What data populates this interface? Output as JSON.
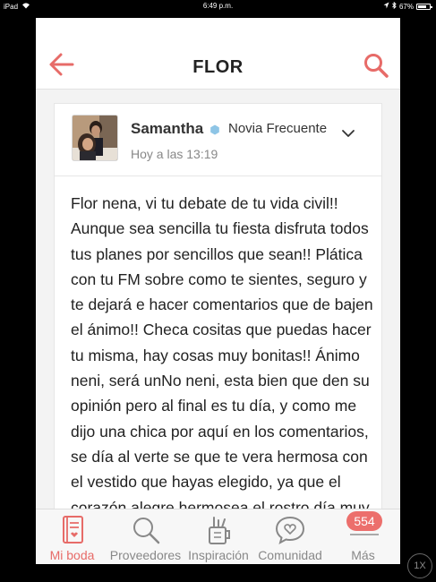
{
  "status_bar": {
    "device": "iPad",
    "time": "6:49 p.m.",
    "battery": "67%"
  },
  "header": {
    "title": "FLOR"
  },
  "post": {
    "author": "Samantha",
    "badge": "Novia Frecuente",
    "timestamp": "Hoy a las 13:19",
    "body": "Flor nena, vi tu debate de tu vida civil!! Aunque sea sencilla tu fiesta disfruta todos tus planes por sencillos que sean!! Plática con tu FM sobre como te sientes, seguro y te dejará e hacer comentarios que de bajen el ánimo!! Checa cositas que puedas hacer tu misma, hay cosas muy bonitas!! Ánimo neni, será unNo neni, esta bien que den su opinión pero al final es tu día, y como me dijo una chica por aquí en los comentarios, se día al verte se que te vera hermosa con el vestido que hayas elegido, ya que el corazón alegre hermosea el rostro día muy"
  },
  "tabs": [
    {
      "label": "Mi boda",
      "icon": "book-icon",
      "active": true
    },
    {
      "label": "Proveedores",
      "icon": "search-icon",
      "active": false
    },
    {
      "label": "Inspiración",
      "icon": "pencil-cup-icon",
      "active": false
    },
    {
      "label": "Comunidad",
      "icon": "heart-chat-icon",
      "active": false
    },
    {
      "label": "Más",
      "icon": "menu-icon",
      "active": false,
      "badge": "554"
    }
  ],
  "speed_control": "1X",
  "colors": {
    "accent": "#e76b68",
    "badge": "#ec6f6c",
    "header_bg": "#ffffff",
    "page_bg": "#f3f3f3",
    "verified_dot": "#8ec5e6"
  }
}
